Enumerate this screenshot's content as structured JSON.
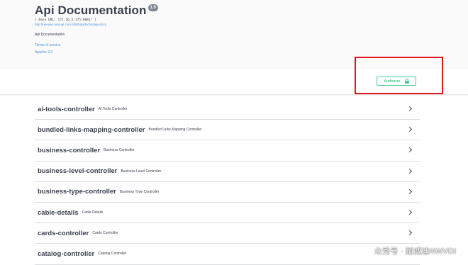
{
  "info": {
    "title": "Api Documentation",
    "version": "1.0",
    "base_url": "[ Base URL: 172.16.5.175:8081/ ]",
    "spec_url": "http://release.nvisual.com:8080/apidoc/v2/api-docs",
    "description": "Api Documentation",
    "terms_link": "Terms of service",
    "license_link": "Apache 2.0"
  },
  "authorize": {
    "label": "Authorize",
    "icon": "lock-icon",
    "accent_color": "#49cc90"
  },
  "highlight_color": "#e0151b",
  "tags": [
    {
      "name": "ai-tools-controller",
      "description": "AI Tools Controller"
    },
    {
      "name": "bundled-links-mapping-controller",
      "description": "Bundled Links Mapping Controller"
    },
    {
      "name": "business-controller",
      "description": "Business Controller"
    },
    {
      "name": "business-level-controller",
      "description": "Business Level Controller"
    },
    {
      "name": "business-type-controller",
      "description": "Business Type Controller"
    },
    {
      "name": "cable-details",
      "description": "Cable Details"
    },
    {
      "name": "cards-controller",
      "description": "Cards Controller"
    },
    {
      "name": "catalog-controller",
      "description": "Catalog Controller"
    }
  ],
  "watermark": "众秀号 · 耐威迪NWVDI"
}
